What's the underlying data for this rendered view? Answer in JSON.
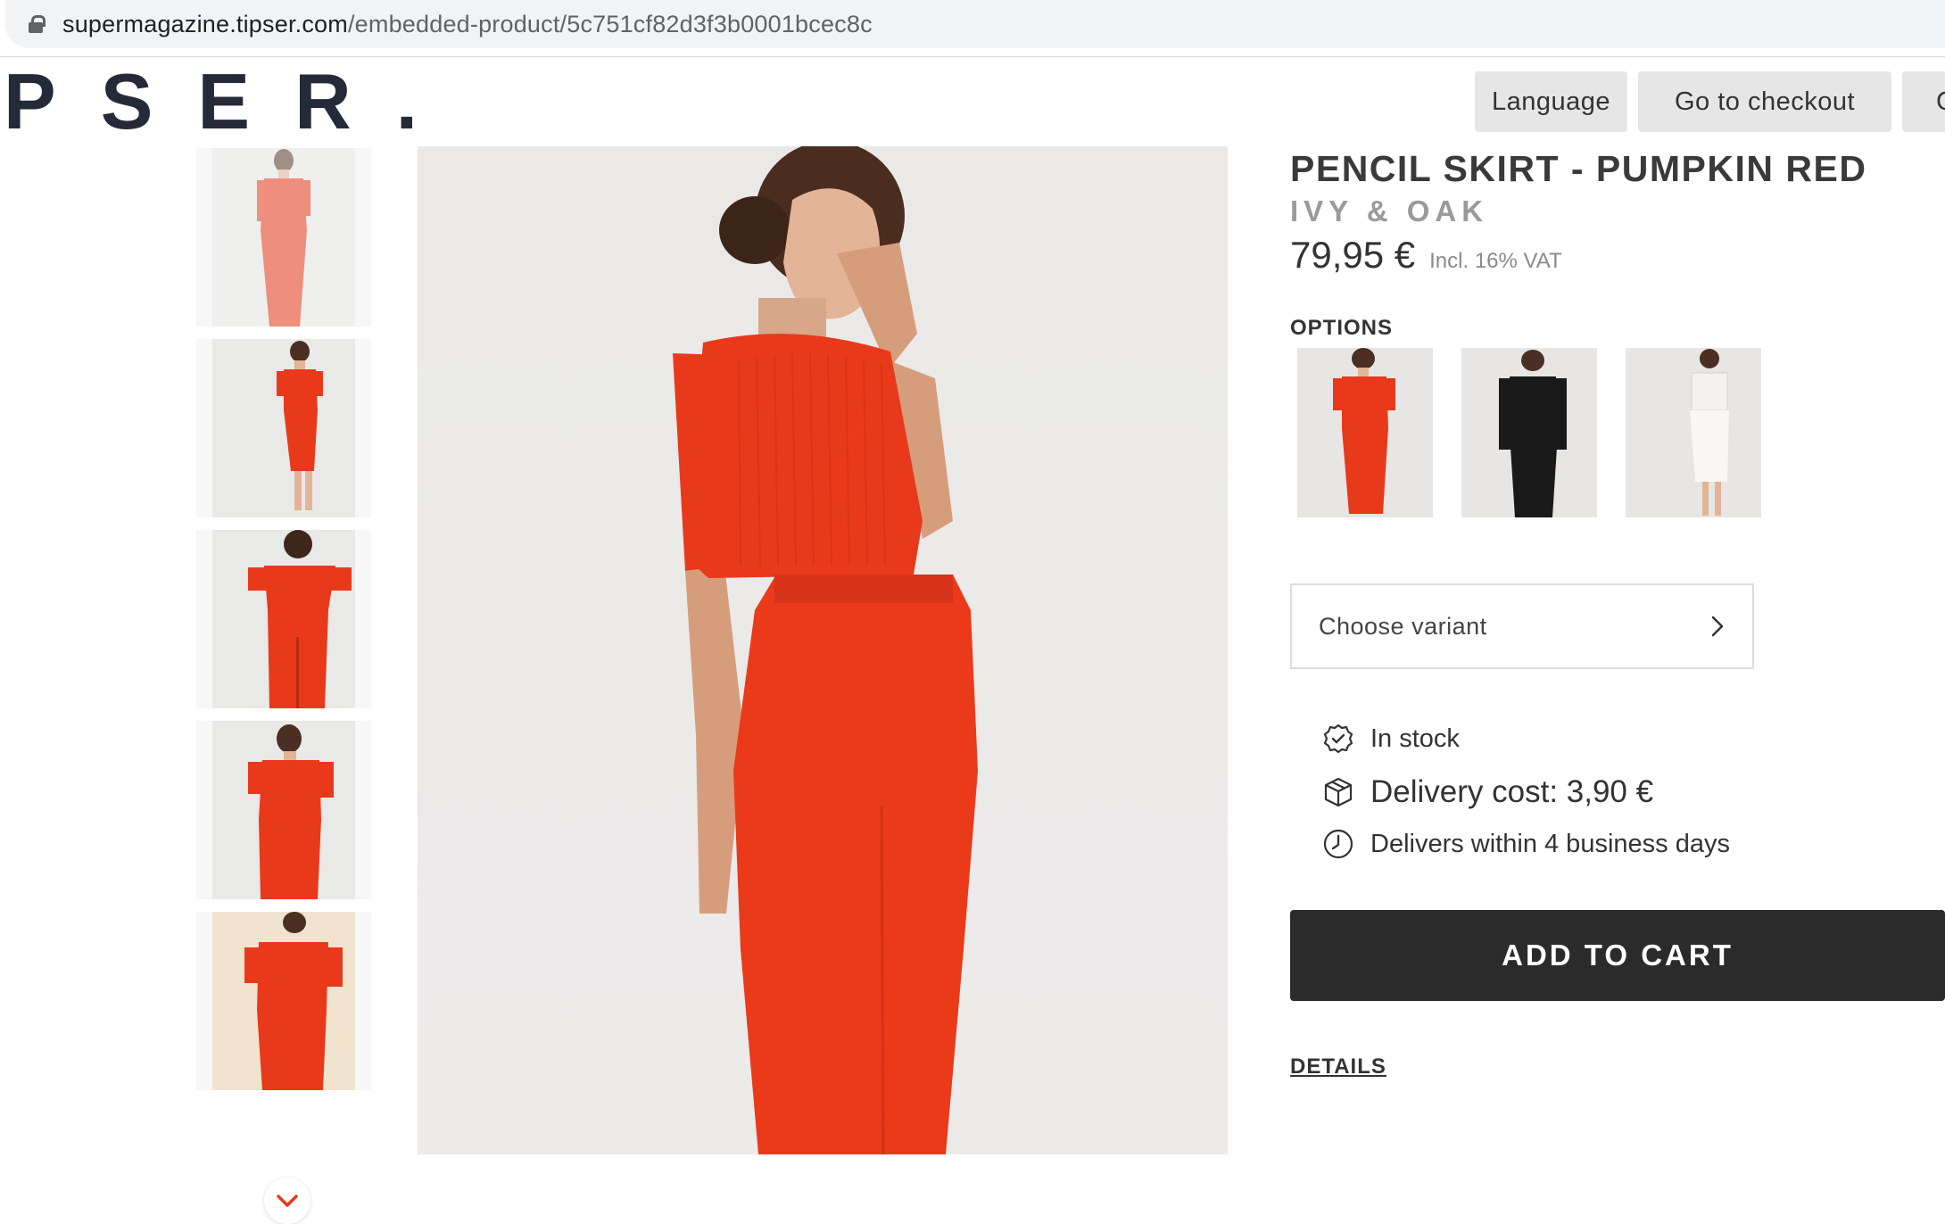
{
  "browser": {
    "url_host": "supermagazine.tipser.com",
    "url_path": "/embedded-product/5c751cf82d3f3b0001bcec8c"
  },
  "header": {
    "logo": "PSER.",
    "language_label": "Language",
    "checkout_label": "Go to checkout",
    "more_label": "C"
  },
  "product": {
    "title": "PENCIL SKIRT - PUMPKIN RED",
    "brand": "IVY & OAK",
    "price": "79,95 €",
    "vat_note": "Incl. 16% VAT",
    "options_label": "OPTIONS",
    "options": [
      {
        "name": "red-dress-option",
        "selected": true,
        "color": "#e8391b"
      },
      {
        "name": "black-lace-dress-option",
        "selected": false,
        "color": "#1a1a1a"
      },
      {
        "name": "white-lace-dress-option",
        "selected": false,
        "color": "#f4f2ee"
      }
    ],
    "variant_placeholder": "Choose variant",
    "stock_text": "In stock",
    "delivery_cost": "Delivery cost: 3,90 €",
    "delivery_time": "Delivers within 4 business days",
    "add_to_cart": "ADD TO CART",
    "details": "DETAILS"
  },
  "colors": {
    "product_red": "#e8391b",
    "button_dark": "#2b2b2b",
    "logo_navy": "#252a38"
  },
  "icons": [
    "lock-icon",
    "chevron-right-icon",
    "chevron-down-icon",
    "verified-badge-icon",
    "box-icon",
    "clock-icon"
  ]
}
